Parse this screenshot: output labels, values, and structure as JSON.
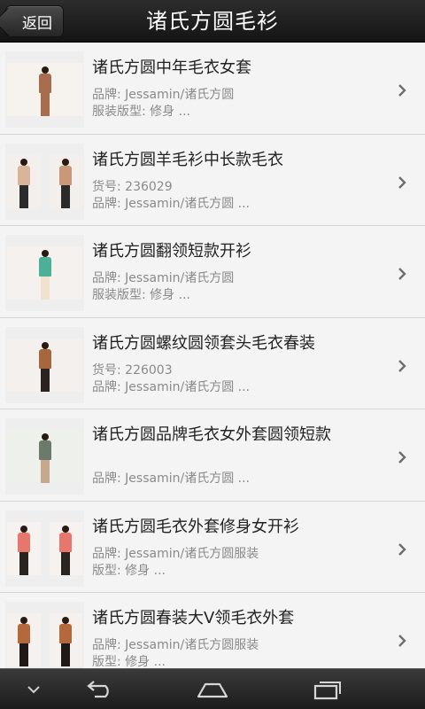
{
  "header": {
    "back_label": "返回",
    "title": "诸氏方圆毛衫"
  },
  "products": [
    {
      "name": "诸氏方圆中年毛衣女套",
      "line1": "品牌: Jessamin/诸氏方圆",
      "line2": "服装版型: 修身 ...",
      "thumb": {
        "layout": "single",
        "figures": [
          {
            "top": "#a86d4f",
            "bottom": "#a86d4f",
            "bg": "#f6f3ef"
          }
        ]
      }
    },
    {
      "name": "诸氏方圆羊毛衫中长款毛衣",
      "line1": "货号: 236029",
      "line2": "品牌: Jessamin/诸氏方圆 ...",
      "thumb": {
        "layout": "double",
        "figures": [
          {
            "top": "#d9b39a",
            "bottom": "#2b2b2b",
            "bg": "#f2efec"
          },
          {
            "top": "#c99878",
            "bottom": "#2b2b2b",
            "bg": "#f2efec"
          }
        ]
      }
    },
    {
      "name": "诸氏方圆翻领短款开衫",
      "line1": "品牌: Jessamin/诸氏方圆",
      "line2": "服装版型: 修身 ...",
      "thumb": {
        "layout": "single",
        "figures": [
          {
            "top": "#4bb095",
            "bottom": "#efe3d0",
            "bg": "#f4f1ee"
          }
        ]
      }
    },
    {
      "name": "诸氏方圆螺纹圆领套头毛衣春装",
      "line1": "货号: 226003",
      "line2": "品牌: Jessamin/诸氏方圆 ...",
      "thumb": {
        "layout": "single",
        "figures": [
          {
            "top": "#a6663e",
            "bottom": "#2a2320",
            "bg": "#f3f0ed"
          }
        ]
      }
    },
    {
      "name": "诸氏方圆品牌毛衣女外套圆领短款",
      "line1": "",
      "line2": "品牌: Jessamin/诸氏方圆 ...",
      "thumb": {
        "layout": "single",
        "figures": [
          {
            "top": "#6c7a6c",
            "bottom": "#c7a88c",
            "bg": "#eef0ec"
          }
        ]
      }
    },
    {
      "name": "诸氏方圆毛衣外套修身女开衫",
      "line1": "品牌: Jessamin/诸氏方圆服装",
      "line2": "版型: 修身 ...",
      "thumb": {
        "layout": "double",
        "figures": [
          {
            "top": "#e7776d",
            "bottom": "#2a2420",
            "bg": "#f5f2ef"
          },
          {
            "top": "#e7776d",
            "bottom": "#2a2420",
            "bg": "#f5f2ef"
          }
        ]
      }
    },
    {
      "name": "诸氏方圆春装大V领毛衣外套",
      "line1": "品牌: Jessamin/诸氏方圆服装",
      "line2": "版型: 修身 ...",
      "thumb": {
        "layout": "double",
        "figures": [
          {
            "top": "#b4683c",
            "bottom": "#1f1a17",
            "bg": "#f4f1ee"
          },
          {
            "top": "#b4683c",
            "bottom": "#1f1a17",
            "bg": "#f4f1ee"
          }
        ]
      }
    }
  ],
  "nav_icons": [
    "chevron-down-icon",
    "back-arrow-icon",
    "home-icon",
    "recent-apps-icon"
  ]
}
